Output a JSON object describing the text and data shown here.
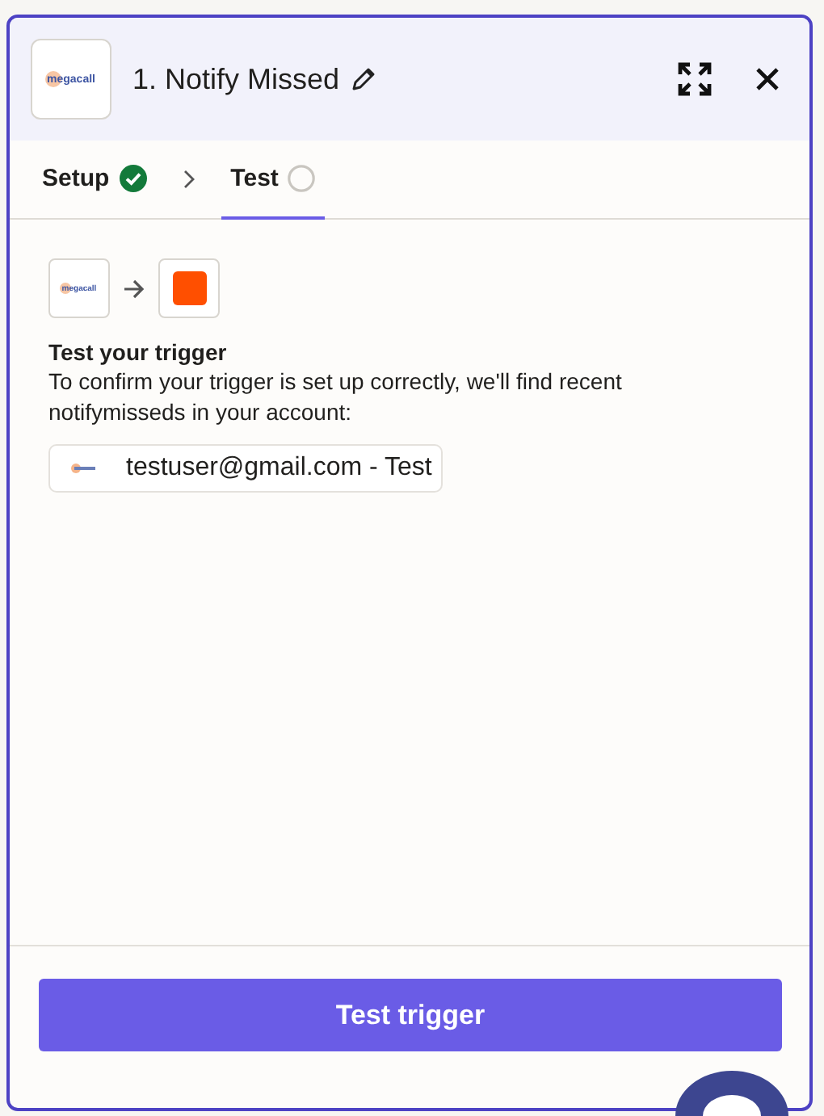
{
  "header": {
    "logo_text": "megacall",
    "title": "1. Notify Missed"
  },
  "tabs": [
    {
      "label": "Setup",
      "selected": false,
      "complete": true
    },
    {
      "label": "Test",
      "selected": true,
      "complete": false
    }
  ],
  "flow": {
    "logo_text": "megacall"
  },
  "section": {
    "heading": "Test your trigger",
    "description": "To confirm your trigger is set up correctly, we'll find recent notifymisseds in your account:"
  },
  "records": [
    {
      "label": "testuser@gmail.com - Test"
    }
  ],
  "footer": {
    "button": "Test trigger"
  }
}
